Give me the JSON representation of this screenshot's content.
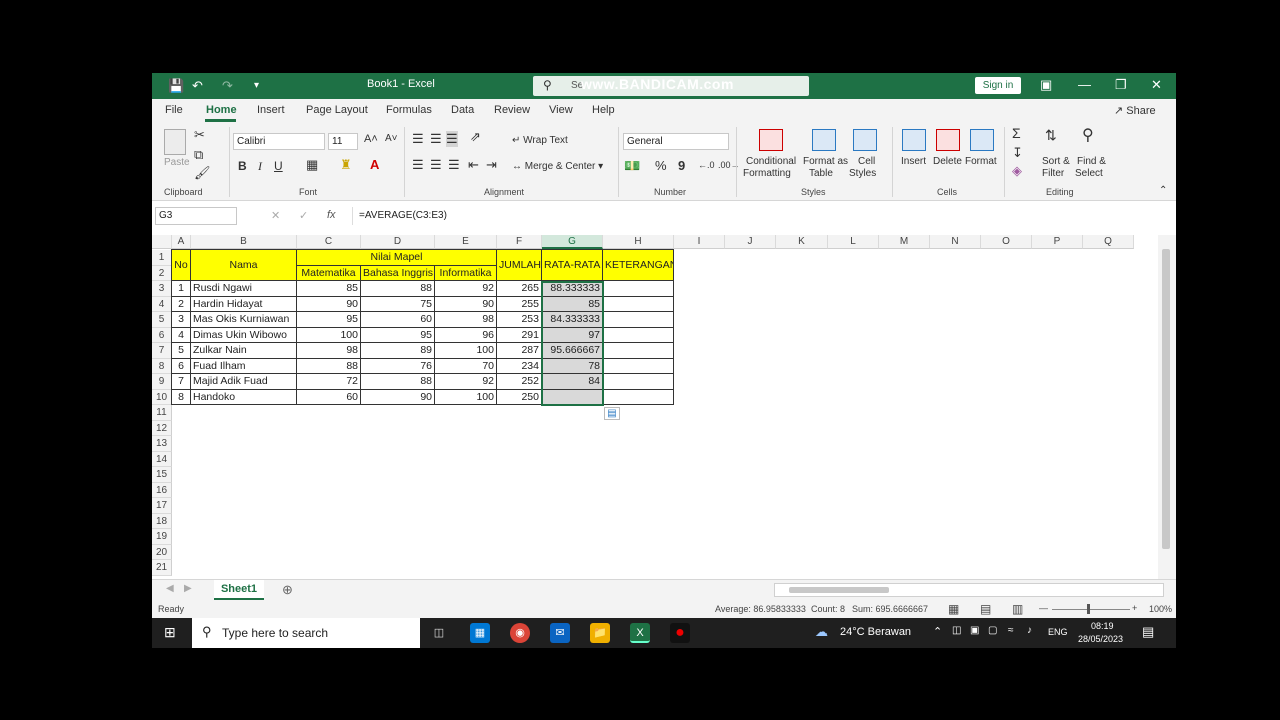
{
  "titlebar": {
    "title": "Book1  -  Excel",
    "search_text": "Se",
    "watermark": "www.BANDICAM.com",
    "sign_in": "Sign in"
  },
  "menu": {
    "tabs": [
      "File",
      "Home",
      "Insert",
      "Page Layout",
      "Formulas",
      "Data",
      "Review",
      "View",
      "Help"
    ],
    "share": "Share"
  },
  "ribbon": {
    "clipboard": {
      "label": "Clipboard",
      "paste": "Paste"
    },
    "font": {
      "label": "Font",
      "name": "Calibri",
      "size": "11",
      "bold": "B",
      "italic": "I",
      "underline": "U"
    },
    "alignment": {
      "label": "Alignment",
      "wrap": "Wrap Text",
      "merge": "Merge & Center"
    },
    "number": {
      "label": "Number",
      "format": "General",
      "percent": "%",
      "comma": "9"
    },
    "styles": {
      "label": "Styles",
      "conditional": [
        "Conditional",
        "Formatting"
      ],
      "format_table": [
        "Format as",
        "Table"
      ],
      "cell_styles": [
        "Cell",
        "Styles"
      ]
    },
    "cells": {
      "label": "Cells",
      "insert": "Insert",
      "delete": "Delete",
      "format": "Format"
    },
    "editing": {
      "label": "Editing",
      "sort": [
        "Sort &",
        "Filter"
      ],
      "find": [
        "Find &",
        "Select"
      ]
    }
  },
  "formula_bar": {
    "name_box": "G3",
    "fx": "fx",
    "formula": "=AVERAGE(C3:E3)"
  },
  "columns": [
    "A",
    "B",
    "C",
    "D",
    "E",
    "F",
    "G",
    "H",
    "I",
    "J",
    "K",
    "L",
    "M",
    "N",
    "O",
    "P",
    "Q"
  ],
  "rows": [
    "1",
    "2",
    "3",
    "4",
    "5",
    "6",
    "7",
    "8",
    "9",
    "10",
    "11",
    "12",
    "13",
    "14",
    "15",
    "16",
    "17",
    "18",
    "19",
    "20",
    "21"
  ],
  "header": {
    "no": "No",
    "nama": "Nama",
    "nilai_mapel": "Nilai Mapel",
    "matematika": "Matematika",
    "bahasa": "Bahasa Inggris",
    "informatika": "Informatika",
    "jumlah": "JUMLAH",
    "rata": "RATA-RATA",
    "keterangan": "KETERANGAN"
  },
  "students": [
    {
      "no": "1",
      "nama": "Rusdi Ngawi",
      "mat": "85",
      "bing": "88",
      "inf": "92",
      "jumlah": "265",
      "rata": "88.333333"
    },
    {
      "no": "2",
      "nama": "Hardin Hidayat",
      "mat": "90",
      "bing": "75",
      "inf": "90",
      "jumlah": "255",
      "rata": "85"
    },
    {
      "no": "3",
      "nama": "Mas Okis Kurniawan",
      "mat": "95",
      "bing": "60",
      "inf": "98",
      "jumlah": "253",
      "rata": "84.333333"
    },
    {
      "no": "4",
      "nama": "Dimas Ukin Wibowo",
      "mat": "100",
      "bing": "95",
      "inf": "96",
      "jumlah": "291",
      "rata": "97"
    },
    {
      "no": "5",
      "nama": "Zulkar Nain",
      "mat": "98",
      "bing": "89",
      "inf": "100",
      "jumlah": "287",
      "rata": "95.666667"
    },
    {
      "no": "6",
      "nama": "Fuad Ilham",
      "mat": "88",
      "bing": "76",
      "inf": "70",
      "jumlah": "234",
      "rata": "78"
    },
    {
      "no": "7",
      "nama": "Majid Adik Fuad",
      "mat": "72",
      "bing": "88",
      "inf": "92",
      "jumlah": "252",
      "rata": "84"
    },
    {
      "no": "8",
      "nama": "Handoko",
      "mat": "60",
      "bing": "90",
      "inf": "100",
      "jumlah": "250",
      "rata": ""
    }
  ],
  "sheet_tab": "Sheet1",
  "status": {
    "ready": "Ready",
    "average": "Average: 86.95833333",
    "count": "Count: 8",
    "sum": "Sum: 695.6666667",
    "zoom": "100%"
  },
  "taskbar": {
    "search": "Type here to search",
    "weather": "24°C  Berawan",
    "lang": "ENG",
    "time": "08:19",
    "date": "28/05/2023"
  },
  "colors": {
    "excel_green": "#1e7145",
    "header_yellow": "#ffff00"
  }
}
